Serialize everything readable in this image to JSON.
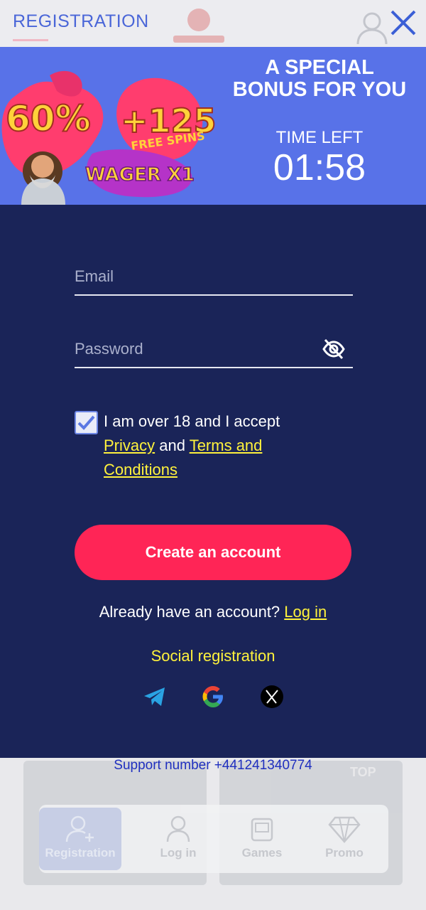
{
  "header": {
    "title": "REGISTRATION"
  },
  "banner": {
    "art_texts": [
      "60%",
      "+125",
      "FREE SPINS",
      "WAGER X1"
    ],
    "bonus_title": "A SPECIAL BONUS FOR YOU",
    "time_left_label": "TIME LEFT",
    "timer": "01:58"
  },
  "form": {
    "email_placeholder": "Email",
    "password_placeholder": "Password",
    "consent_checked": true,
    "consent_text": "I am over 18 and I accept",
    "privacy_link": "Privacy",
    "and_text": "and",
    "terms_link": "Terms and Conditions",
    "create_button": "Create an account",
    "have_account_text": "Already have an account?",
    "login_link": "Log in",
    "social_title": "Social registration",
    "social_icons": [
      "telegram-icon",
      "google-icon",
      "x-icon"
    ]
  },
  "support": {
    "text": "Support number +441241340774"
  },
  "background": {
    "card_badge": "TOP"
  },
  "tabbar": {
    "tabs": [
      {
        "label": "Registration",
        "icon": "user-plus-icon",
        "active": true
      },
      {
        "label": "Log in",
        "icon": "user-icon",
        "active": false
      },
      {
        "label": "Games",
        "icon": "games-icon",
        "active": false
      },
      {
        "label": "Promo",
        "icon": "diamond-icon",
        "active": false
      }
    ]
  },
  "colors": {
    "header_title": "#4a66d8",
    "banner_bg": "#5872e8",
    "panel_bg": "#1a2458",
    "link_yellow": "#fff23c",
    "button_pink": "#ff2556"
  }
}
